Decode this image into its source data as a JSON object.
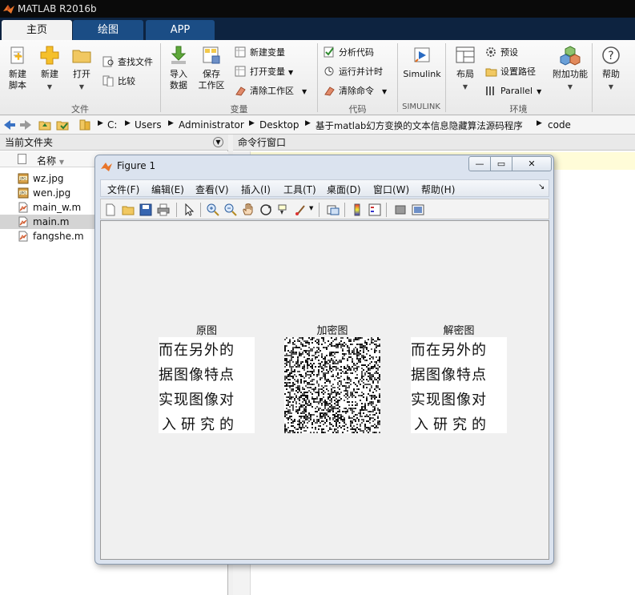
{
  "window": {
    "title": "MATLAB R2016b"
  },
  "tabs": [
    {
      "label": "主页",
      "active": true
    },
    {
      "label": "绘图",
      "active": false
    },
    {
      "label": "APP",
      "active": false
    }
  ],
  "ribbon": {
    "new_script": "新建\n脚本",
    "new_script_l1": "新建",
    "new_script_l2": "脚本",
    "new": "新建",
    "open": "打开",
    "find_files": "查找文件",
    "compare": "比较",
    "import_l1": "导入",
    "import_l2": "数据",
    "save_ws_l1": "保存",
    "save_ws_l2": "工作区",
    "new_var": "新建变量",
    "open_var": "打开变量",
    "clear_ws": "清除工作区",
    "analyze_code": "分析代码",
    "run_time": "运行并计时",
    "clear_cmd": "清除命令",
    "simulink": "Simulink",
    "layout": "布局",
    "preferences": "预设",
    "set_path": "设置路径",
    "parallel": "Parallel",
    "addons": "附加功能",
    "help": "帮助",
    "groups": {
      "file": "文件",
      "variable": "变量",
      "code": "代码",
      "simulink": "SIMULINK",
      "environment": "环境"
    }
  },
  "address": {
    "crumbs": [
      "C:",
      "Users",
      "Administrator",
      "Desktop",
      "基于matlab幻方变换的文本信息隐藏算法源码程序",
      "code"
    ]
  },
  "current_folder": {
    "title": "当前文件夹",
    "column_name": "名称",
    "files": [
      {
        "name": "wz.jpg",
        "type": "jpg",
        "selected": false
      },
      {
        "name": "wen.jpg",
        "type": "jpg",
        "selected": false
      },
      {
        "name": "main_w.m",
        "type": "m",
        "selected": false
      },
      {
        "name": "main.m",
        "type": "m",
        "selected": true
      },
      {
        "name": "fangshe.m",
        "type": "m",
        "selected": false
      }
    ]
  },
  "command_window": {
    "title": "命令行窗口"
  },
  "figure": {
    "title": "Figure 1",
    "menus": [
      "文件(F)",
      "编辑(E)",
      "查看(V)",
      "插入(I)",
      "工具(T)",
      "桌面(D)",
      "窗口(W)",
      "帮助(H)"
    ],
    "axes": [
      {
        "title": "原图",
        "lines": [
          "而在另外的",
          "据图像特点",
          "实现图像对",
          "入研究的"
        ]
      },
      {
        "title": "加密图"
      },
      {
        "title": "解密图",
        "lines": [
          "而在另外的",
          "据图像特点",
          "实现图像对",
          "入研究的"
        ]
      }
    ]
  },
  "colors": {
    "accent": "#1b4d85",
    "titlebar": "#0a0a0a",
    "tab_strip": "#0d2340"
  }
}
